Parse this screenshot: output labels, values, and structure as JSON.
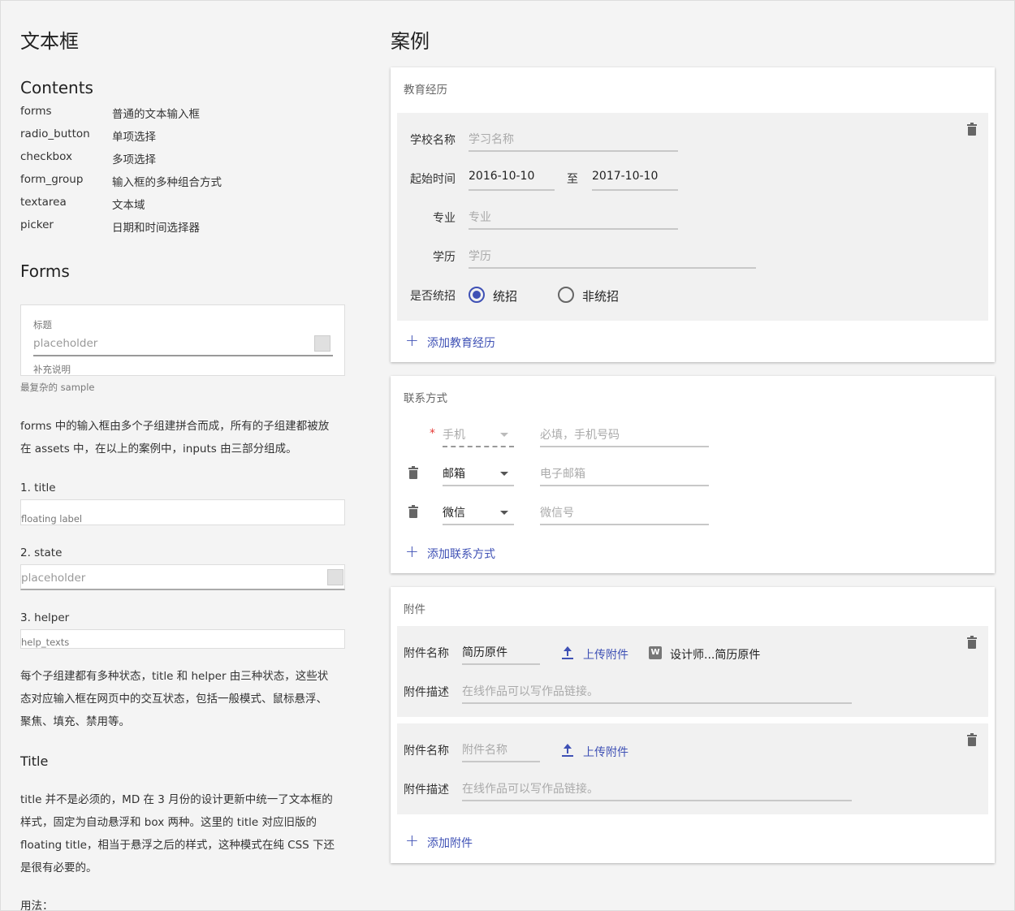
{
  "left": {
    "title": "文本框",
    "contents_heading": "Contents",
    "toc": [
      {
        "key": "forms",
        "value": "普通的文本输入框"
      },
      {
        "key": "radio_button",
        "value": "单项选择"
      },
      {
        "key": "checkbox",
        "value": "多项选择"
      },
      {
        "key": "form_group",
        "value": "输入框的多种组合方式"
      },
      {
        "key": "textarea",
        "value": "文本域"
      },
      {
        "key": "picker",
        "value": "日期和时间选择器"
      }
    ],
    "forms_heading": "Forms",
    "demo": {
      "label": "标题",
      "placeholder": "placeholder",
      "helper": "补充说明",
      "caption": "最复杂的 sample"
    },
    "para1_line1": "forms 中的输入框由多个子组建拼合而成，所有的子组建都被放",
    "para1_line2": "在 assets 中，在以上的案例中，inputs 由三部分组成。",
    "item1": "1. title",
    "item1_demo": "floating label",
    "item2": "2. state",
    "item2_demo": "placeholder",
    "item3": "3. helper",
    "item3_demo": "help_texts",
    "para2_line1": "每个子组建都有多种状态，title 和 helper 由三种状态，这些状",
    "para2_line2": "态对应输入框在网页中的交互状态，包括一般模式、鼠标悬浮、",
    "para2_line3": "聚焦、填充、禁用等。",
    "title_heading": "Title",
    "para3_line1": "title 并不是必须的，MD 在 3 月份的设计更新中统一了文本框的",
    "para3_line2": "样式，固定为自动悬浮和 box 两种。这里的 title 对应旧版的",
    "para3_line3": "floating title，相当于悬浮之后的样式，这种模式在纯 CSS 下还",
    "para3_line4": "是很有必要的。",
    "usage": "用法："
  },
  "right": {
    "title": "案例",
    "education": {
      "card_title": "教育经历",
      "school_label": "学校名称",
      "school_placeholder": "学习名称",
      "start_label": "起始时间",
      "start_value": "2016-10-10",
      "to_label": "至",
      "end_value": "2017-10-10",
      "major_label": "专业",
      "major_placeholder": "专业",
      "degree_label": "学历",
      "degree_placeholder": "学历",
      "recruit_label": "是否统招",
      "option_yes": "统招",
      "option_no": "非统招",
      "add_label": "添加教育经历"
    },
    "contact": {
      "card_title": "联系方式",
      "required_mark": "*",
      "rows": [
        {
          "type": "手机",
          "placeholder": "必填，手机号码"
        },
        {
          "type": "邮箱",
          "placeholder": "电子邮箱"
        },
        {
          "type": "微信",
          "placeholder": "微信号"
        }
      ],
      "add_label": "添加联系方式"
    },
    "attachment": {
      "card_title": "附件",
      "name_label": "附件名称",
      "desc_label": "附件描述",
      "item1_name": "简历原件",
      "upload_label": "上传附件",
      "item1_file": "设计师...简历原件",
      "desc_placeholder": "在线作品可以写作品链接。",
      "item2_name_placeholder": "附件名称",
      "add_label": "添加附件"
    }
  },
  "colors": {
    "accent": "#3f51b5",
    "background": "#f4f4f4",
    "panel": "#f1f1f1"
  }
}
